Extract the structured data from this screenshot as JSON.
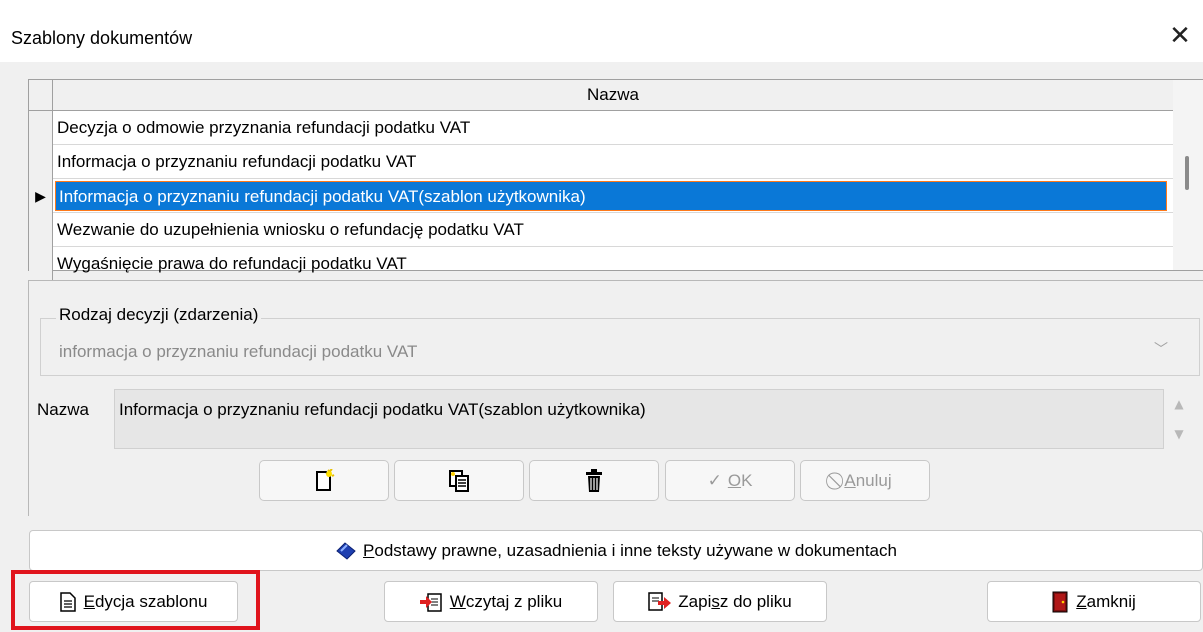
{
  "window": {
    "title": "Szablony dokumentów",
    "close_glyph": "✕"
  },
  "grid": {
    "column_header": "Nazwa",
    "rows": [
      {
        "label": "Decyzja o odmowie przyznania refundacji podatku VAT",
        "selected": false
      },
      {
        "label": "Informacja o przyznaniu refundacji podatku VAT",
        "selected": false
      },
      {
        "label": "Informacja o przyznaniu refundacji podatku VAT(szablon użytkownika)",
        "selected": true
      },
      {
        "label": "Wezwanie do uzupełnienia wniosku o refundację podatku VAT",
        "selected": false
      },
      {
        "label": "Wygaśnięcie prawa do refundacji podatku VAT",
        "selected": false
      }
    ],
    "row_indicator_glyph": "▶"
  },
  "detail": {
    "group_label": "Rodzaj decyzji (zdarzenia)",
    "decision_type_value": "informacja o przyznaniu refundacji podatku VAT",
    "name_label": "Nazwa",
    "name_value": "Informacja o przyznaniu refundacji podatku VAT(szablon użytkownika)",
    "toolbar": {
      "ok_label": "OK",
      "ok_mnemonic": "O",
      "ok_rest": "K",
      "cancel_label": "Anuluj",
      "cancel_mnemonic": "A",
      "cancel_rest": "nuluj"
    }
  },
  "buttons": {
    "legal_bases": {
      "mnemonic": "P",
      "rest": "odstawy prawne, uzasadnienia i inne teksty używane w dokumentach"
    },
    "edit_template": {
      "pre": "E",
      "rest": "dycja szablonu"
    },
    "load_from_file": {
      "mnemonic": "W",
      "rest": "czytaj z pliku"
    },
    "save_to_file": {
      "pre": "Zapi",
      "mnemonic": "s",
      "rest": "z do pliku"
    },
    "close": {
      "mnemonic": "Z",
      "rest": "amknij"
    }
  },
  "colors": {
    "selection": "#0a78d7",
    "highlight_frame": "#e0141c",
    "focus_border": "#ff7a1a"
  }
}
